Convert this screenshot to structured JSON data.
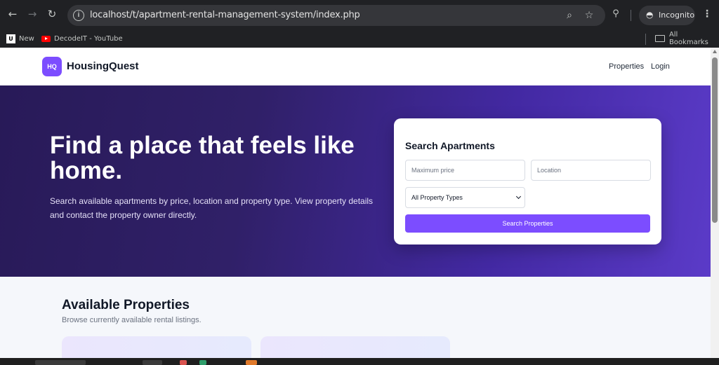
{
  "browser": {
    "url": "localhost/t/apartment-rental-management-system/index.php",
    "incognito_label": "Incognito",
    "bookmarks": [
      {
        "label": "New",
        "icon": "new-page-icon"
      },
      {
        "label": "DecodeIT - YouTube",
        "icon": "youtube-icon"
      }
    ],
    "all_bookmarks_label": "All Bookmarks"
  },
  "site": {
    "logo_badge": "HQ",
    "brand": "HousingQuest",
    "nav": [
      "Properties",
      "Login"
    ],
    "accent_color": "#7c4dff"
  },
  "hero": {
    "title": "Find a place that feels like home.",
    "subtitle": "Search available apartments by price, location and property type. View property details and contact the property owner directly."
  },
  "search": {
    "title": "Search Apartments",
    "max_price_placeholder": "Maximum price",
    "location_placeholder": "Location",
    "property_type_selected": "All Property Types",
    "button_label": "Search Properties"
  },
  "properties": {
    "title": "Available Properties",
    "subtitle": "Browse currently available rental listings."
  }
}
